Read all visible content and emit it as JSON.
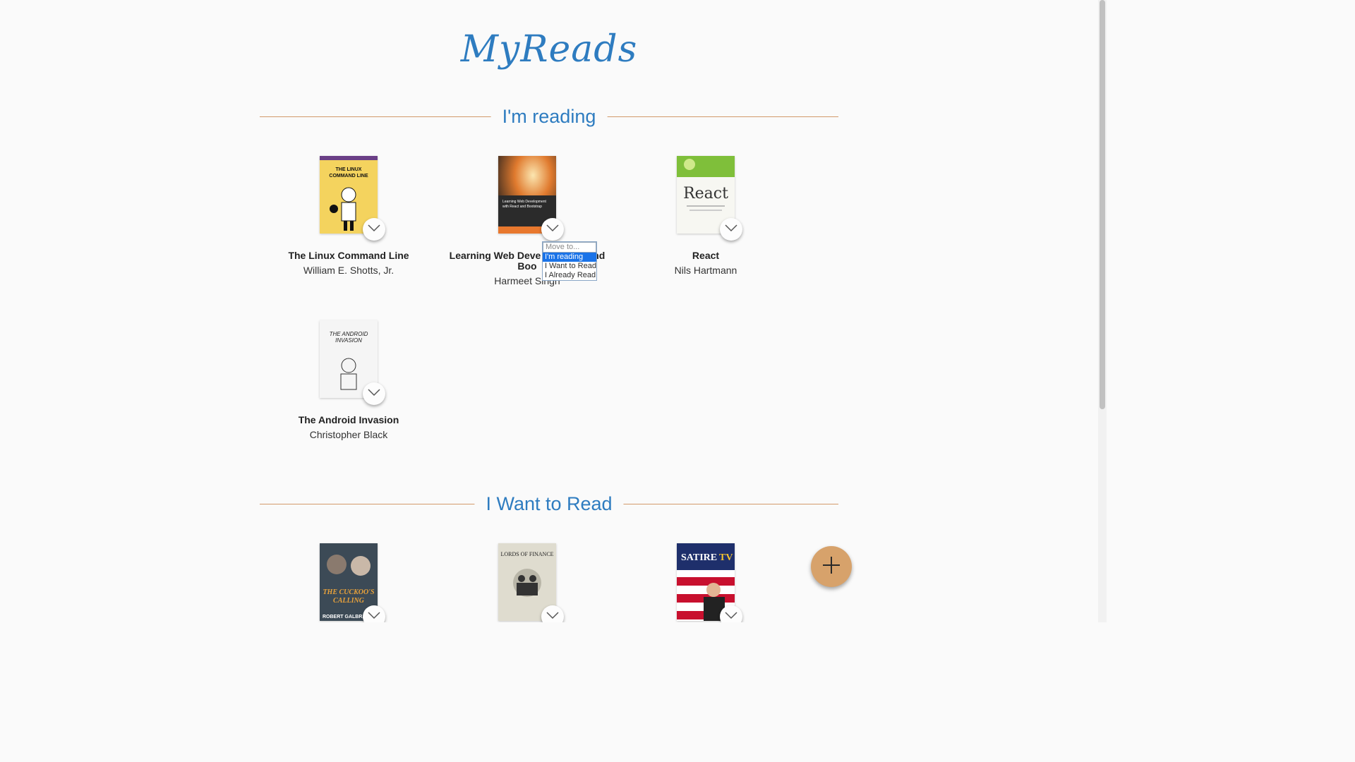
{
  "app": {
    "title": "MyReads"
  },
  "shelves": [
    {
      "title": "I'm reading",
      "books": [
        {
          "title": "The Linux Command Line",
          "author": "William E. Shotts, Jr.",
          "cover_text": "THE LINUX COMMAND LINE"
        },
        {
          "title": "Learning Web Development with React and Bootstrap",
          "title_display": "Learning Web Deve   n React and Boo",
          "author": "Harmeet Singh",
          "cover_text": "Learning Web Development with React and Bootstrap"
        },
        {
          "title": "React",
          "author": "Nils Hartmann",
          "cover_text": "React"
        },
        {
          "title": "The Android Invasion",
          "author": "Christopher Black",
          "cover_text": "THE ANDROID INVASION"
        }
      ]
    },
    {
      "title": "I Want to Read",
      "books": [
        {
          "cover_text": "THE CUCKOO'S CALLING",
          "cover_author": "ROBERT GALBRA"
        },
        {
          "cover_text": "LORDS OF FINANCE"
        },
        {
          "cover_text": "SATIRE TV"
        }
      ]
    }
  ],
  "shelf_menu": {
    "options": [
      "Move to...",
      "I'm reading",
      "I Want to Read",
      "I Already Read"
    ],
    "selected": "I'm reading"
  },
  "icons": {
    "shelf_changer": "chevron-down-icon",
    "add": "plus-icon"
  },
  "colors": {
    "title": "#2e7cc0",
    "accent": "#d7a26b",
    "divider": "#d29a6a"
  }
}
